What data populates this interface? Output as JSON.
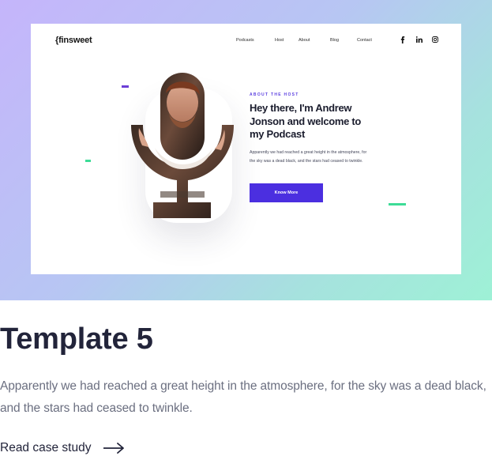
{
  "preview": {
    "logo": "{finsweet",
    "nav": [
      "Podcasts",
      "Host",
      "About",
      "Blog",
      "Contact"
    ],
    "social_icons": [
      "facebook-icon",
      "linkedin-icon",
      "instagram-icon"
    ],
    "eyebrow": "ABOUT THE HOST",
    "title": "Hey there, I'm Andrew Jonson and welcome to my Podcast",
    "description": "Apparently we had reached a great height in the atmosphere, for the sky was a dead black, and the stars had ceased to twinkle.",
    "cta_label": "Know More",
    "colors": {
      "primary": "#4b2fe0",
      "accent_green": "#3ddc97",
      "accent_purple": "#6c3fd6"
    }
  },
  "card": {
    "title": "Template 5",
    "description": "Apparently we had reached a great height in the atmosphere, for the sky was a dead black, and the stars had ceased to twinkle.",
    "link_label": "Read case study",
    "link_icon": "arrow-right-icon"
  }
}
